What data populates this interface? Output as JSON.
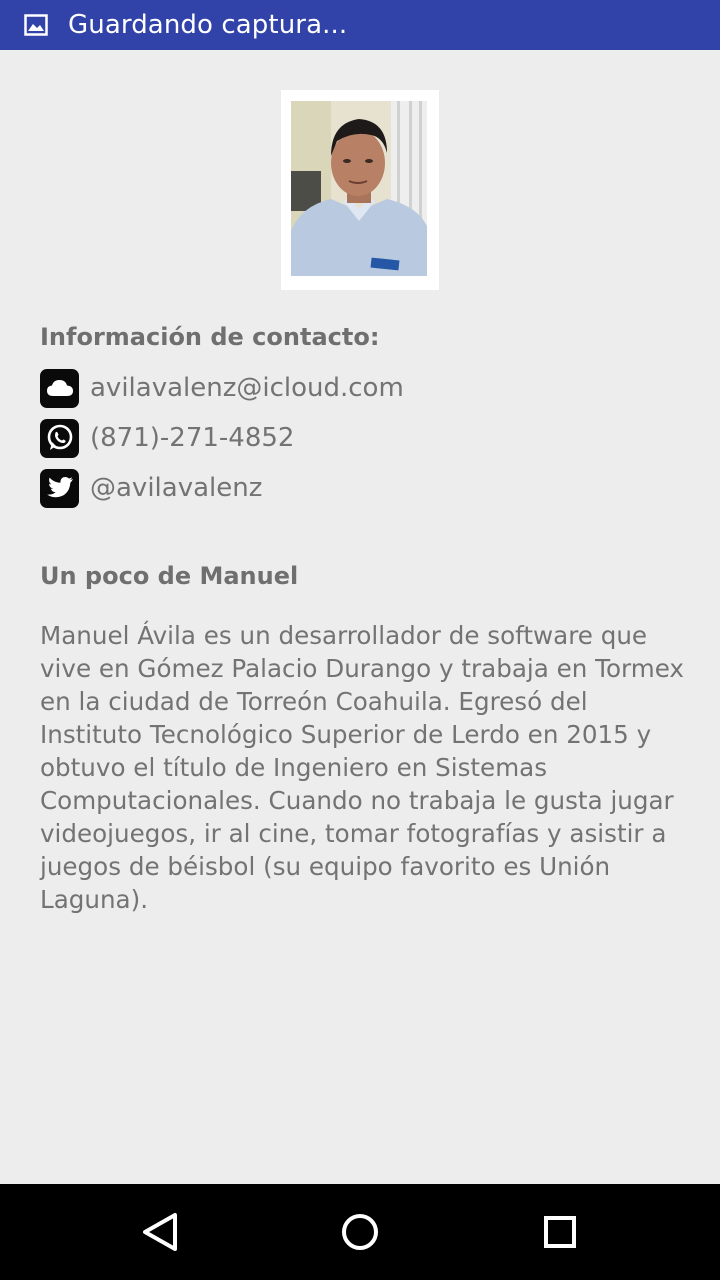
{
  "status_bar": {
    "notification_icon": "image-icon",
    "text": "Guardando captura..."
  },
  "profile": {
    "photo_icon": "profile-photo"
  },
  "contact": {
    "title": "Información de contacto:",
    "items": [
      {
        "icon": "icloud-icon",
        "text": "avilavalenz@icloud.com"
      },
      {
        "icon": "whatsapp-icon",
        "text": "(871)-271-4852"
      },
      {
        "icon": "twitter-icon",
        "text": "@avilavalenz"
      }
    ]
  },
  "about": {
    "title": "Un poco de Manuel",
    "text": "Manuel Ávila es un desarrollador de software que vive en Gómez Palacio Durango y trabaja en Tormex en la ciudad de Torreón Coahuila. Egresó del Instituto Tecnológico Superior de Lerdo en 2015 y obtuvo el título de Ingeniero en Sistemas Computacionales. Cuando no trabaja le gusta jugar videojuegos, ir al cine, tomar fotografías y asistir a juegos de béisbol (su equipo favorito es Unión Laguna)."
  },
  "navigation": {
    "back_icon": "back-triangle-icon",
    "home_icon": "home-circle-icon",
    "recents_icon": "recents-square-icon"
  },
  "colors": {
    "status_bar": "#3142a8",
    "background": "#ededed",
    "text": "#737373",
    "heading": "#6f6f6f",
    "nav_bar": "#000000"
  }
}
